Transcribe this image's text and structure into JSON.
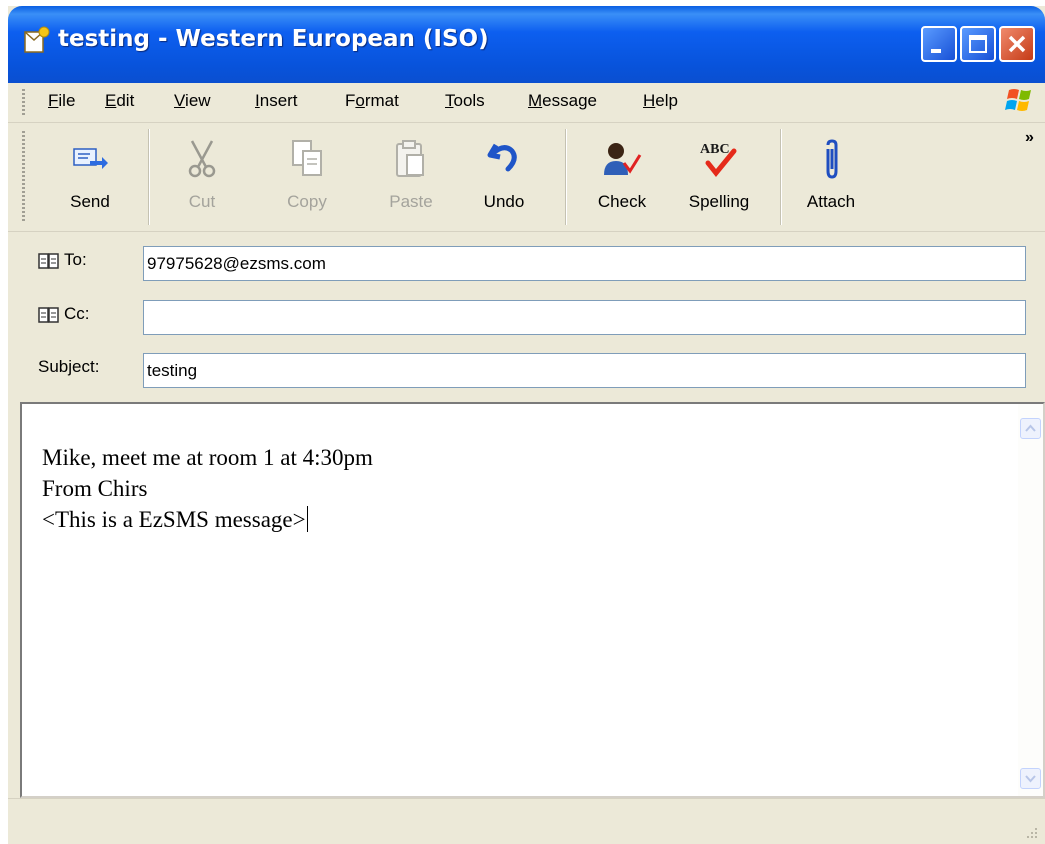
{
  "window": {
    "title": "testing - Western European (ISO)",
    "icons": [
      "new-mail-icon",
      "minimize-icon",
      "maximize-icon",
      "close-icon"
    ]
  },
  "menu": {
    "items": [
      {
        "label": "File",
        "mnemonic": "F"
      },
      {
        "label": "Edit",
        "mnemonic": "E"
      },
      {
        "label": "View",
        "mnemonic": "V"
      },
      {
        "label": "Insert",
        "mnemonic": "I"
      },
      {
        "label": "Format",
        "mnemonic": "o"
      },
      {
        "label": "Tools",
        "mnemonic": "T"
      },
      {
        "label": "Message",
        "mnemonic": "M"
      },
      {
        "label": "Help",
        "mnemonic": "H"
      }
    ]
  },
  "toolbar": {
    "send": {
      "label": "Send",
      "icon": "send-icon",
      "enabled": true
    },
    "cut": {
      "label": "Cut",
      "icon": "scissors-icon",
      "enabled": false
    },
    "copy": {
      "label": "Copy",
      "icon": "copy-icon",
      "enabled": false
    },
    "paste": {
      "label": "Paste",
      "icon": "paste-icon",
      "enabled": false
    },
    "undo": {
      "label": "Undo",
      "icon": "undo-icon",
      "enabled": true
    },
    "check": {
      "label": "Check",
      "icon": "check-names-icon",
      "enabled": true
    },
    "spelling": {
      "label": "Spelling",
      "icon": "spelling-icon",
      "enabled": true
    },
    "attach": {
      "label": "Attach",
      "icon": "paperclip-icon",
      "enabled": true
    },
    "overflow": "»"
  },
  "header": {
    "to": {
      "label": "To:",
      "value": "97975628@ezsms.com"
    },
    "cc": {
      "label": "Cc:",
      "value": ""
    },
    "subject": {
      "label": "Subject:",
      "value": "testing"
    }
  },
  "message": {
    "lines": [
      "Mike, meet me at room 1 at 4:30pm",
      "From Chirs",
      "<This is a EzSMS message>"
    ]
  },
  "colors": {
    "titlebar": "#0a56e0",
    "chrome": "#ece9d8",
    "close_button": "#d9532d",
    "disabled_text": "#a4a39c"
  }
}
